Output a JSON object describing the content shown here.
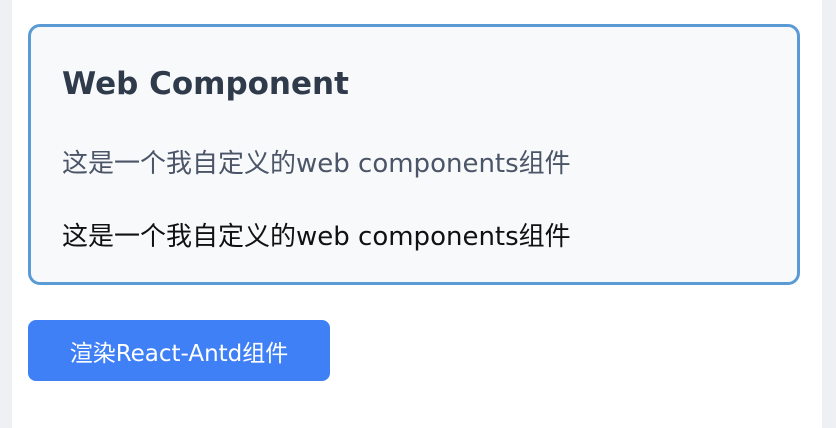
{
  "card": {
    "title": "Web Component",
    "line_1": "这是一个我自定义的web components组件",
    "line_2": "这是一个我自定义的web components组件"
  },
  "render_button": {
    "label": "渲染React-Antd组件"
  },
  "colors": {
    "card_border": "#5b9bd5",
    "card_background": "#f8f9fb",
    "button_background": "#3f80f7"
  }
}
